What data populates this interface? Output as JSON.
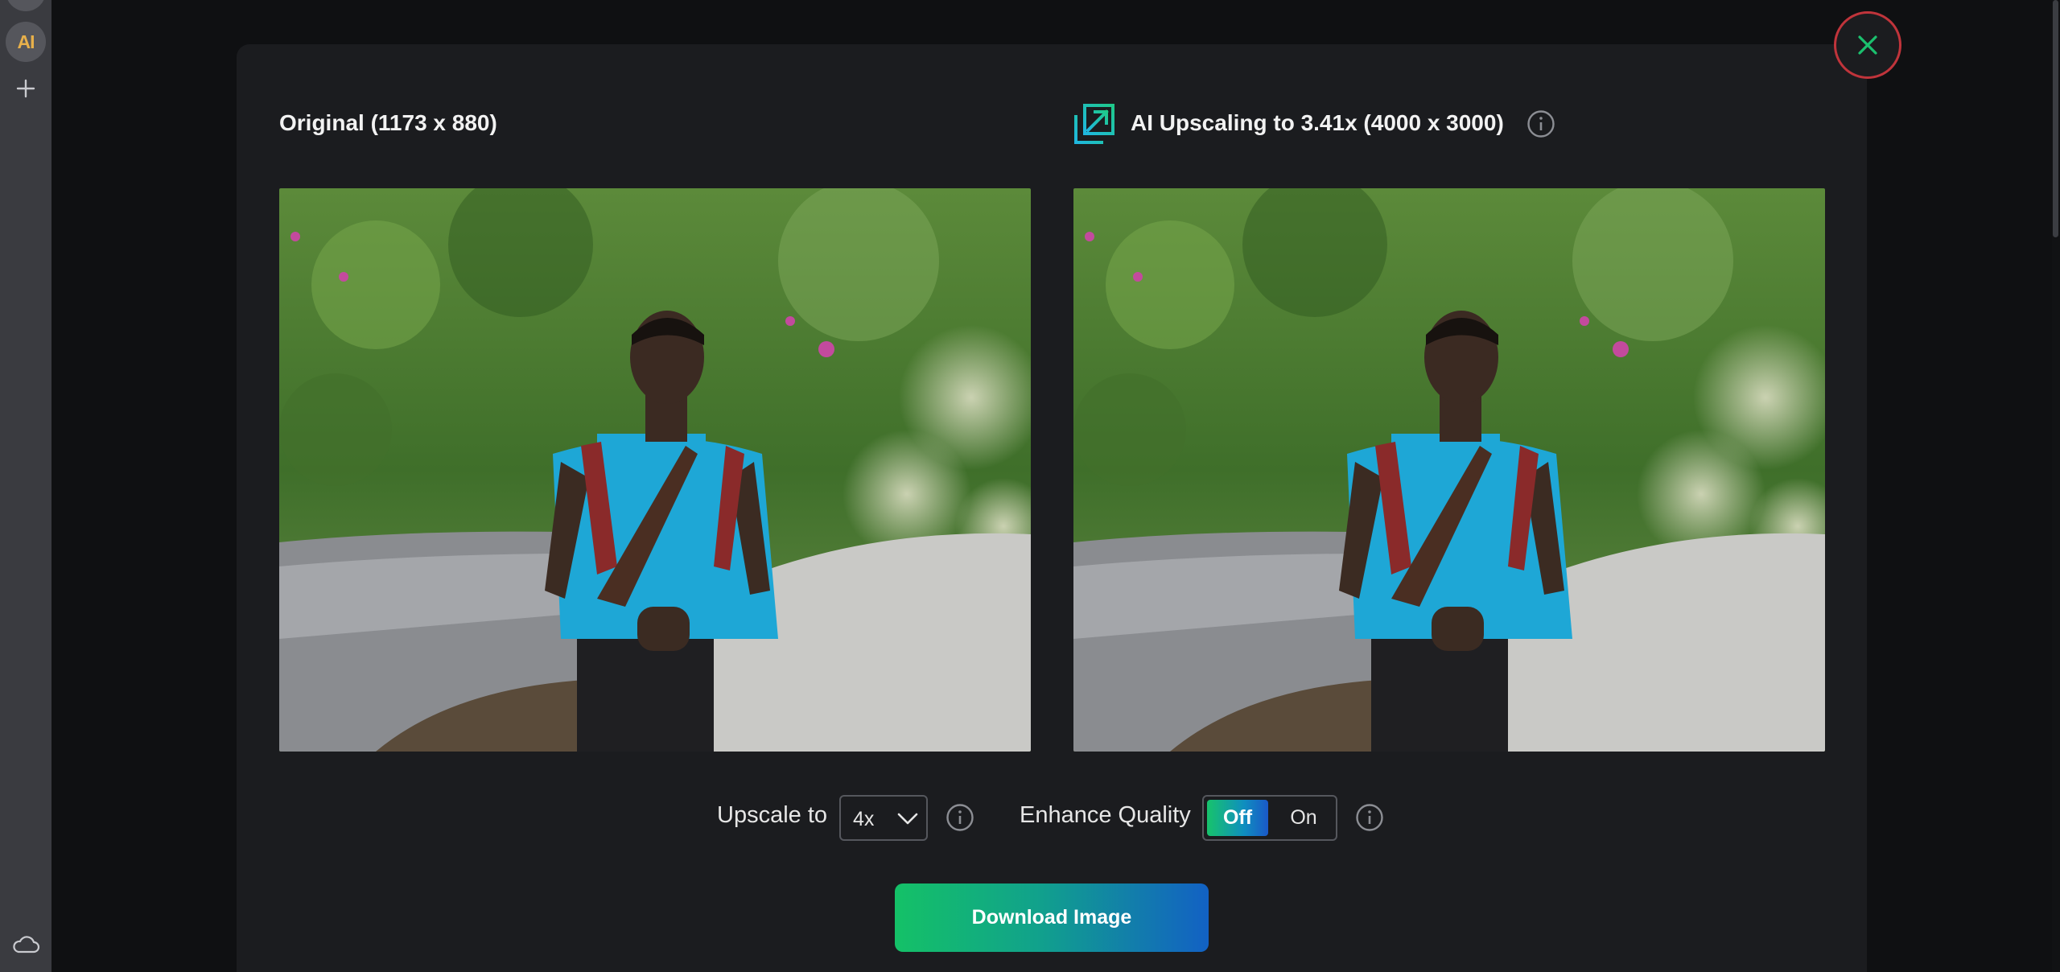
{
  "sidebar": {
    "app_logo_text": "AI",
    "add_icon": "plus-icon",
    "cloud_icon": "cloud-icon"
  },
  "modal": {
    "left_title": "Original (1173 x 880)",
    "right_title": "AI Upscaling to 3.41x (4000 x 3000)",
    "right_title_icon": "upscale-arrow-icon",
    "close_icon": "close-icon"
  },
  "controls": {
    "upscale_label": "Upscale to",
    "upscale_value": "4x",
    "enhance_label": "Enhance Quality",
    "toggle_off": "Off",
    "toggle_on": "On",
    "toggle_selected": "Off"
  },
  "actions": {
    "download_label": "Download Image"
  },
  "colors": {
    "accent_green": "#14c167",
    "accent_blue": "#1261c4",
    "close_red": "#c0343b",
    "modal_bg": "#1b1c1f"
  }
}
